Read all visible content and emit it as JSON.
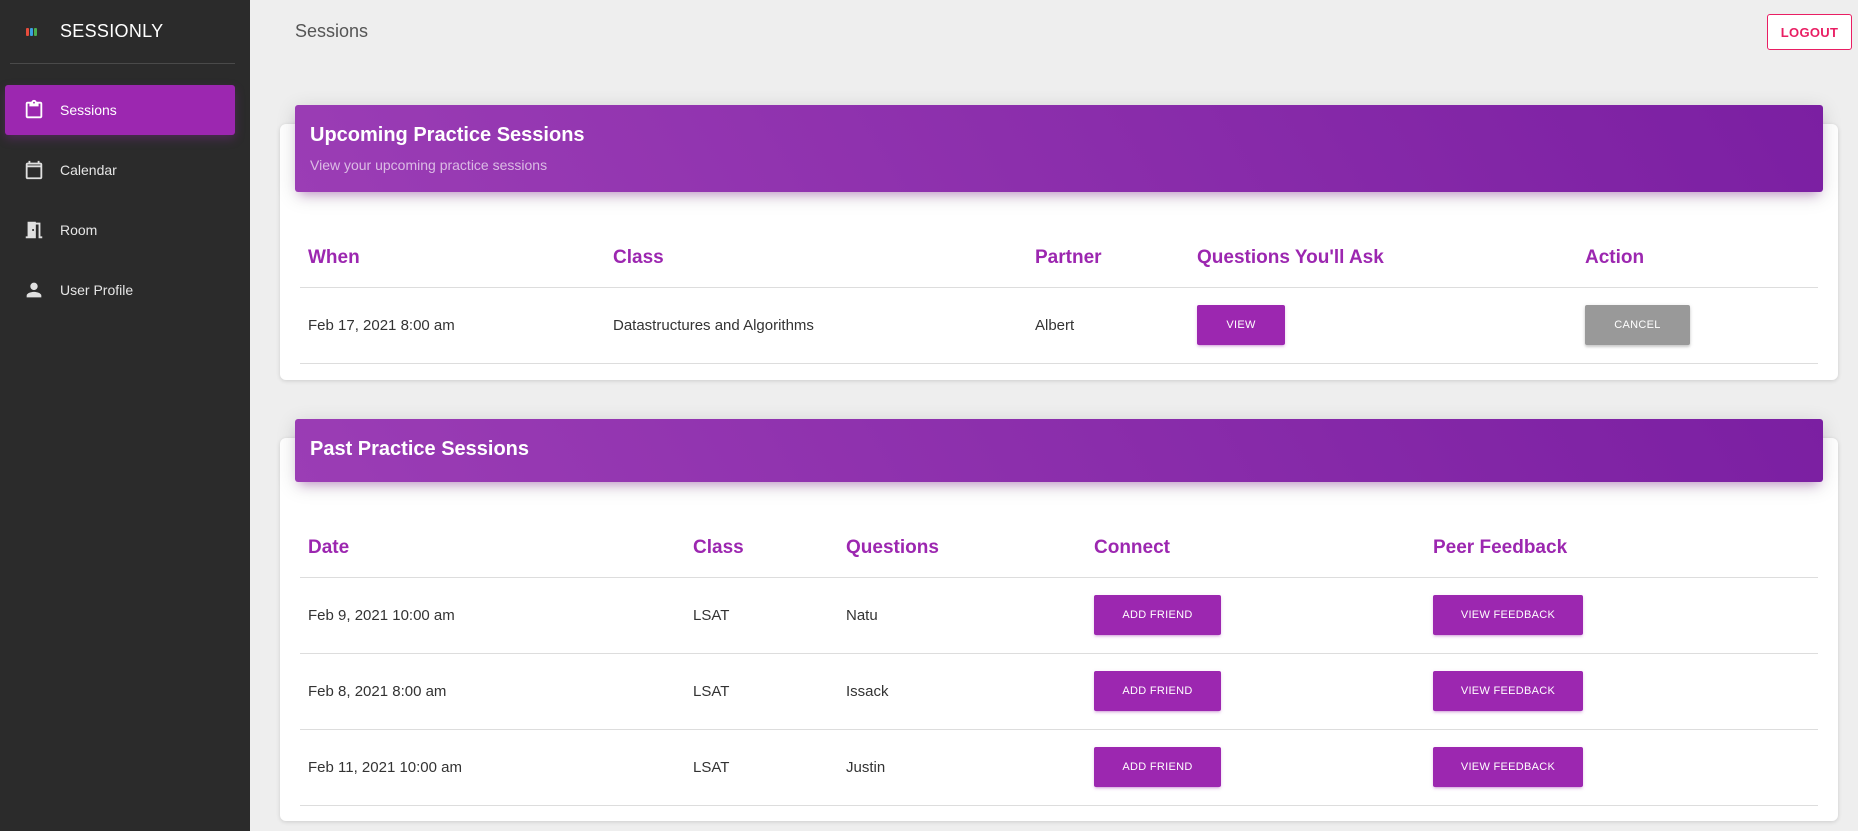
{
  "app": {
    "name": "SESSIONLY"
  },
  "sidebar": {
    "items": [
      {
        "label": "Sessions",
        "icon": "clipboard-icon",
        "active": true
      },
      {
        "label": "Calendar",
        "icon": "calendar-icon",
        "active": false
      },
      {
        "label": "Room",
        "icon": "door-icon",
        "active": false
      },
      {
        "label": "User Profile",
        "icon": "person-icon",
        "active": false
      }
    ]
  },
  "header": {
    "title": "Sessions",
    "logout_label": "LOGOUT"
  },
  "upcoming": {
    "title": "Upcoming Practice Sessions",
    "subtitle": "View your upcoming practice sessions",
    "columns": [
      "When",
      "Class",
      "Partner",
      "Questions You'll Ask",
      "Action"
    ],
    "rows": [
      {
        "when": "Feb 17, 2021 8:00 am",
        "class": "Datastructures and Algorithms",
        "partner": "Albert",
        "view_label": "VIEW",
        "cancel_label": "CANCEL"
      }
    ]
  },
  "past": {
    "title": "Past Practice Sessions",
    "columns": [
      "Date",
      "Class",
      "Questions",
      "Connect",
      "Peer Feedback"
    ],
    "rows": [
      {
        "date": "Feb 9, 2021 10:00 am",
        "class": "LSAT",
        "questions": "Natu",
        "connect_label": "ADD FRIEND",
        "feedback_label": "VIEW FEEDBACK"
      },
      {
        "date": "Feb 8, 2021 8:00 am",
        "class": "LSAT",
        "questions": "Issack",
        "connect_label": "ADD FRIEND",
        "feedback_label": "VIEW FEEDBACK"
      },
      {
        "date": "Feb 11, 2021 10:00 am",
        "class": "LSAT",
        "questions": "Justin",
        "connect_label": "ADD FRIEND",
        "feedback_label": "VIEW FEEDBACK"
      }
    ]
  },
  "colors": {
    "accent": "#9c27b0",
    "sidebar": "#2b2b2b",
    "logout": "#e91e63",
    "cancel": "#999999"
  }
}
